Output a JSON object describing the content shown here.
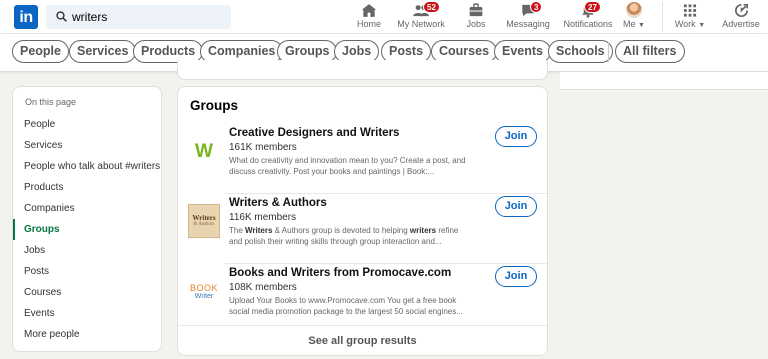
{
  "search": {
    "value": "writers"
  },
  "nav": [
    {
      "key": "home",
      "label": "Home",
      "icon": "home-icon",
      "badge": ""
    },
    {
      "key": "network",
      "label": "My Network",
      "icon": "people-icon",
      "badge": "52"
    },
    {
      "key": "jobs",
      "label": "Jobs",
      "icon": "briefcase-icon",
      "badge": ""
    },
    {
      "key": "messaging",
      "label": "Messaging",
      "icon": "chat-icon",
      "badge": "3"
    },
    {
      "key": "notifications",
      "label": "Notifications",
      "icon": "bell-icon",
      "badge": "27"
    },
    {
      "key": "me",
      "label": "Me",
      "icon": "avatar"
    },
    {
      "key": "work",
      "label": "Work",
      "icon": "grid-icon"
    },
    {
      "key": "advertise",
      "label": "Advertise",
      "icon": "advertise-icon"
    }
  ],
  "filters": [
    "People",
    "Services",
    "Products",
    "Companies",
    "Groups",
    "Jobs",
    "Posts",
    "Courses",
    "Events",
    "Schools"
  ],
  "all_filters": "All filters",
  "sidebar": {
    "heading": "On this page",
    "items": [
      "People",
      "Services",
      "People who talk about #writers",
      "Products",
      "Companies",
      "Groups",
      "Jobs",
      "Posts",
      "Courses",
      "Events",
      "More people"
    ],
    "active": "Groups"
  },
  "groups_section": {
    "title": "Groups",
    "join_label": "Join",
    "see_all": "See all group results",
    "items": [
      {
        "name": "Creative Designers and Writers",
        "members": "161K members",
        "desc_1": "What do creativity and innovation mean to you? Create a post, and",
        "desc_2": "discuss creativity. Post your books and paintings | Book:..."
      },
      {
        "name": "Writers & Authors",
        "members": "116K members",
        "desc_1a": "The ",
        "desc_1b": "Writers",
        "desc_1c": " & Authors group is devoted to helping ",
        "desc_1d": "writers",
        "desc_1e": " refine",
        "desc_2": "and polish their writing skills through group interaction and..."
      },
      {
        "name": "Books and Writers from Promocave.com",
        "members": "108K members",
        "desc_1": "Upload Your Books to www.Promocave.com You get a free book",
        "desc_2": "social media promotion package to the largest 50 social engines..."
      }
    ]
  },
  "logos": {
    "g1_letter": "W",
    "g2_line1": "Writers",
    "g2_line2": "& Authors",
    "g3_line1": "BOOK",
    "g3_line2": "Writer"
  },
  "colors": {
    "brand": "#0a66c2",
    "active_green": "#057642",
    "badge_red": "#cc1016"
  }
}
